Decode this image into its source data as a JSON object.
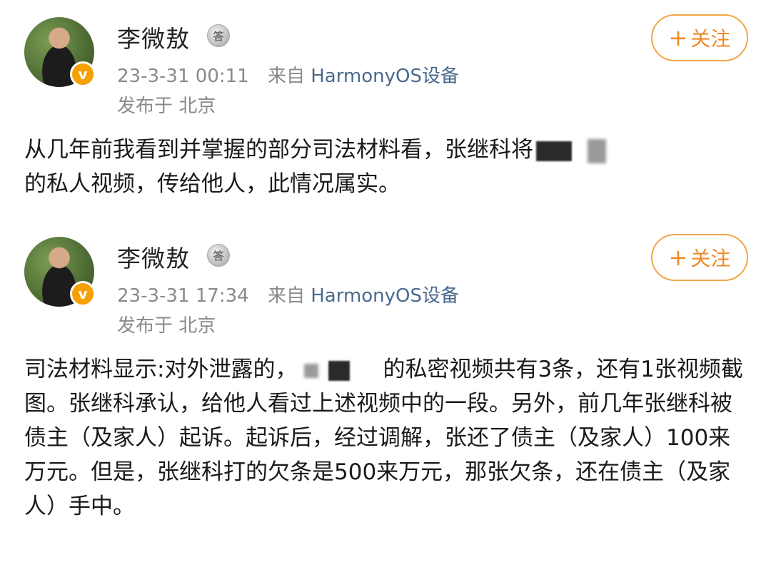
{
  "posts": [
    {
      "username": "李微敖",
      "medal_text": "答",
      "time": "23-3-31 00:11",
      "source_prefix": "来自",
      "device": "HarmonyOS设备",
      "location": "发布于 北京",
      "follow_plus": "+",
      "follow_label": "关注",
      "content_line1": "从几年前我看到并掌握的部分司法材料看，张继科将",
      "content_line2": "的私人视频，传给他人，此情况属实。"
    },
    {
      "username": "李微敖",
      "medal_text": "答",
      "time": "23-3-31 17:34",
      "source_prefix": "来自",
      "device": "HarmonyOS设备",
      "location": "发布于 北京",
      "follow_plus": "+",
      "follow_label": "关注",
      "content_part1": "司法材料显示:对外泄露的，",
      "content_part2": "的私密视频共有3条，还有1张视频截图。张继科承认，给他人看过上述视频中的一段。另外，前几年张继科被债主（及家人）起诉。起诉后，经过调解，张还了债主（及家人）100来万元。但是，张继科打的欠条是500来万元，那张欠条，还在债主（及家人）手中。"
    }
  ],
  "colors": {
    "accent_orange": "#f08a24",
    "device_link": "#4a6a8f",
    "meta_gray": "#8a8a8a"
  }
}
